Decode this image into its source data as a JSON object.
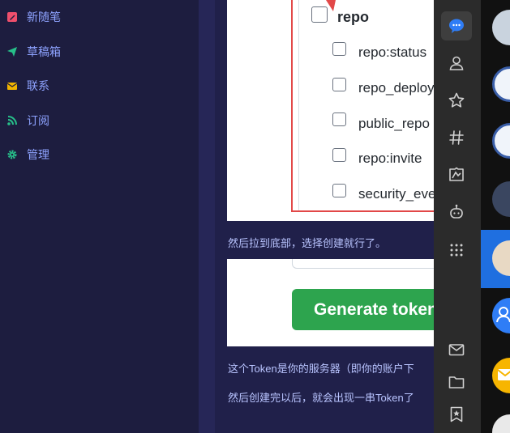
{
  "sidebar": {
    "items": [
      {
        "label": "新随笔",
        "icon": "edit-icon",
        "color": "#ef4f6c"
      },
      {
        "label": "草稿箱",
        "icon": "send-icon",
        "color": "#27c08a"
      },
      {
        "label": "联系",
        "icon": "mail-icon",
        "color": "#f1b400"
      },
      {
        "label": "订阅",
        "icon": "rss-icon",
        "color": "#27c08a"
      },
      {
        "label": "管理",
        "icon": "gear-icon",
        "color": "#27c08a"
      }
    ]
  },
  "scopes": {
    "parent": "repo",
    "children": [
      "repo:status",
      "repo_deployment",
      "public_repo",
      "repo:invite",
      "security_events"
    ]
  },
  "captions": {
    "scroll_to_bottom": "然后拉到底部，选择创建就行了。",
    "token_server": "这个Token是你的服务器（即你的账户下",
    "after_create": "然后创建完以后，就会出现一串Token了"
  },
  "generate_button": "Generate token",
  "rail": {
    "icons": [
      "chat-bubble-icon",
      "contacts-icon",
      "favorites-icon",
      "channels-icon",
      "moments-icon",
      "bot-icon",
      "apps-icon",
      "mail-icon",
      "folder-icon",
      "bookmark-icon"
    ]
  },
  "colors": {
    "accent_green": "#2da44e",
    "highlight_red": "#e24848",
    "active_blue": "#1f6fe0"
  }
}
